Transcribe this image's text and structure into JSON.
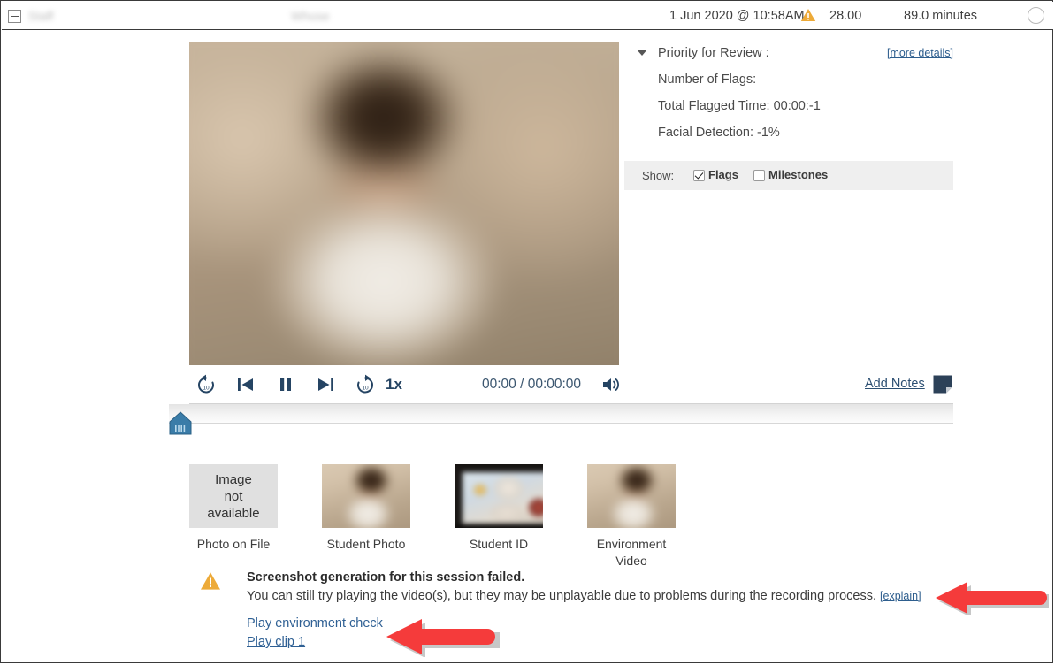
{
  "header": {
    "collapse_icon": "collapse-minus-icon",
    "redacted_left": "Staff",
    "redacted_mid": "Whose",
    "date": "1 Jun 2020 @ 10:58AM",
    "warning_icon": "warning-triangle-icon",
    "score": "28.00",
    "duration": "89.0 minutes",
    "status_circle": "status-circle-icon"
  },
  "video": {
    "region_name": "session-video-player"
  },
  "info_panel": {
    "rows": [
      {
        "label": "Priority for Review :"
      },
      {
        "label": "Number of Flags:"
      },
      {
        "label": "Total Flagged Time: 00:00:-1"
      },
      {
        "label": "Facial Detection: -1%"
      }
    ],
    "more_details": "[more details]",
    "show_label": "Show:",
    "flags_label": "Flags",
    "flags_checked": true,
    "milestones_label": "Milestones",
    "milestones_checked": false
  },
  "controls": {
    "rewind10": "rewind-10-icon",
    "previous": "previous-icon",
    "pause": "pause-icon",
    "next": "next-icon",
    "forward10": "forward-10-icon",
    "speed": "1x",
    "time": "00:00 / 00:00:00",
    "volume": "volume-icon",
    "add_notes": "Add Notes",
    "note_icon": "note-icon"
  },
  "timeline": {
    "scrubber": "timeline-scrubber-handle"
  },
  "thumbnails": [
    {
      "label": "Photo on File",
      "placeholder": "Image\nnot\navailable",
      "kind": "unavailable"
    },
    {
      "label": "Student Photo",
      "kind": "photo"
    },
    {
      "label": "Student ID",
      "kind": "id"
    },
    {
      "label": "Environment Video",
      "kind": "photo"
    }
  ],
  "warning": {
    "icon": "warning-triangle-icon",
    "line1": "Screenshot generation for this session failed.",
    "line2": "You can still try playing the video(s), but they may be unplayable due to problems during the recording process.",
    "explain": "[explain]"
  },
  "play_links": [
    {
      "label": "Play environment check",
      "underlined": false
    },
    {
      "label": "Play clip 1",
      "underlined": true
    }
  ],
  "annotations": {
    "arrow_color": "#f53b3b",
    "arrow_explain": "red-arrow-pointing-to-explain",
    "arrow_play": "red-arrow-pointing-to-play-links"
  },
  "colors": {
    "link": "#2f6094",
    "warning": "#edaa38",
    "control": "#254463",
    "panel_bg": "#efefef",
    "scrubber": "#3a7ca8"
  }
}
